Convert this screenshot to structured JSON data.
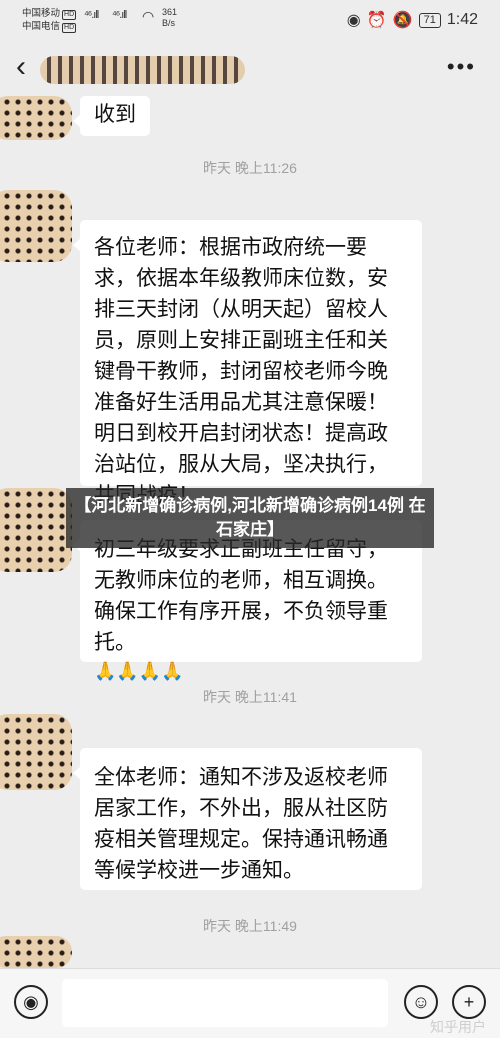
{
  "status_bar": {
    "carrier1": "中国移动",
    "carrier1_badge": "HD",
    "carrier2": "中国电信",
    "carrier2_badge": "HD",
    "signal1": "⁴⁶.ıll",
    "signal2": "⁴⁶.ıll",
    "speed_value": "361",
    "speed_unit": "B/s",
    "battery": "71",
    "time": "1:42"
  },
  "header": {
    "back_icon": "‹",
    "more_icon": "•••"
  },
  "messages": [
    {
      "text": "收到"
    },
    {
      "text": "各位老师：根据市政府统一要求，依据本年级教师床位数，安排三天封闭（从明天起）留校人员，原则上安排正副班主任和关键骨干教师，封闭留校老师今晚准备好生活用品尤其注意保暖！明日到校开启封闭状态！提高政治站位，服从大局，坚决执行，共同战疫！"
    },
    {
      "text": "初三年级要求正副班主任留守，无教师床位的老师，相互调换。确保工作有序开展，不负领导重托。",
      "emojis": "🙏🙏🙏🙏"
    },
    {
      "text": "全体老师：通知不涉及返校老师 居家工作，不外出，服从社区防疫相关管理规定。保持通讯畅通等候学校进一步通知。"
    }
  ],
  "timestamps": [
    "昨天 晚上11:26",
    "昨天 晚上11:41",
    "昨天 晚上11:49"
  ],
  "banner": {
    "text": "【河北新增确诊病例,河北新增确诊病例14例 在石家庄】"
  },
  "bottom_bar": {
    "voice_icon": "voice-icon",
    "emoji_icon": "emoji-icon",
    "add_icon": "add-icon",
    "watermark": "知乎用户"
  }
}
